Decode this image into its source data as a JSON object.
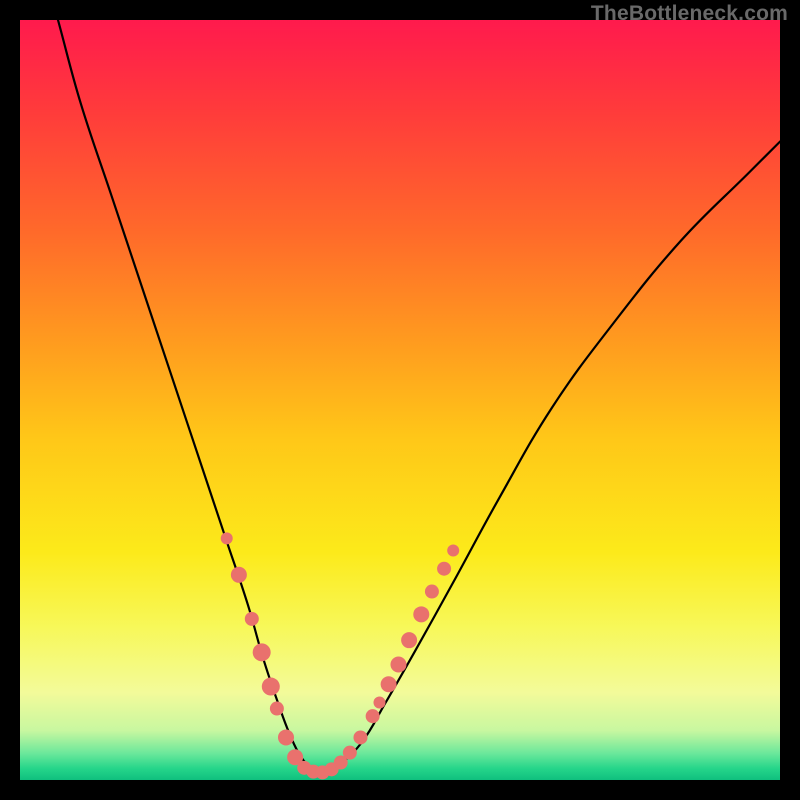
{
  "watermark": "TheBottleneck.com",
  "chart_data": {
    "type": "line",
    "title": "",
    "xlabel": "",
    "ylabel": "",
    "xlim": [
      0,
      100
    ],
    "ylim": [
      0,
      100
    ],
    "background_gradient": {
      "stops": [
        {
          "pos": 0.0,
          "color": "#ff1a4d"
        },
        {
          "pos": 0.12,
          "color": "#ff3b3b"
        },
        {
          "pos": 0.28,
          "color": "#ff6a2a"
        },
        {
          "pos": 0.42,
          "color": "#ff9a1f"
        },
        {
          "pos": 0.55,
          "color": "#ffc718"
        },
        {
          "pos": 0.7,
          "color": "#fcea1a"
        },
        {
          "pos": 0.8,
          "color": "#f7f85a"
        },
        {
          "pos": 0.885,
          "color": "#f3fb9a"
        },
        {
          "pos": 0.935,
          "color": "#c8f7a0"
        },
        {
          "pos": 0.965,
          "color": "#6be89b"
        },
        {
          "pos": 0.985,
          "color": "#25d58a"
        },
        {
          "pos": 1.0,
          "color": "#0fbf7e"
        }
      ]
    },
    "series": [
      {
        "name": "bottleneck-curve",
        "x": [
          5,
          8,
          12,
          16,
          20,
          24,
          27,
          30,
          32,
          34,
          35.5,
          37,
          38.5,
          40,
          42,
          45,
          48,
          52,
          57,
          63,
          70,
          78,
          87,
          96,
          100
        ],
        "y": [
          100,
          89,
          77,
          65,
          53,
          41,
          32,
          23,
          16,
          10,
          6,
          3,
          1.5,
          1,
          2,
          5,
          10,
          17,
          26,
          37,
          49,
          60,
          71,
          80,
          84
        ]
      }
    ],
    "markers": {
      "name": "dot-markers",
      "color": "#e9716d",
      "points": [
        {
          "x": 27.2,
          "y": 31.8,
          "r": 6
        },
        {
          "x": 28.8,
          "y": 27.0,
          "r": 8
        },
        {
          "x": 30.5,
          "y": 21.2,
          "r": 7
        },
        {
          "x": 31.8,
          "y": 16.8,
          "r": 9
        },
        {
          "x": 33.0,
          "y": 12.3,
          "r": 9
        },
        {
          "x": 33.8,
          "y": 9.4,
          "r": 7
        },
        {
          "x": 35.0,
          "y": 5.6,
          "r": 8
        },
        {
          "x": 36.2,
          "y": 3.0,
          "r": 8
        },
        {
          "x": 37.4,
          "y": 1.6,
          "r": 7
        },
        {
          "x": 38.6,
          "y": 1.1,
          "r": 7
        },
        {
          "x": 39.8,
          "y": 1.0,
          "r": 7
        },
        {
          "x": 41.0,
          "y": 1.4,
          "r": 7
        },
        {
          "x": 42.2,
          "y": 2.3,
          "r": 7
        },
        {
          "x": 43.4,
          "y": 3.6,
          "r": 7
        },
        {
          "x": 44.8,
          "y": 5.6,
          "r": 7
        },
        {
          "x": 46.4,
          "y": 8.4,
          "r": 7
        },
        {
          "x": 47.3,
          "y": 10.2,
          "r": 6
        },
        {
          "x": 48.5,
          "y": 12.6,
          "r": 8
        },
        {
          "x": 49.8,
          "y": 15.2,
          "r": 8
        },
        {
          "x": 51.2,
          "y": 18.4,
          "r": 8
        },
        {
          "x": 52.8,
          "y": 21.8,
          "r": 8
        },
        {
          "x": 54.2,
          "y": 24.8,
          "r": 7
        },
        {
          "x": 55.8,
          "y": 27.8,
          "r": 7
        },
        {
          "x": 57.0,
          "y": 30.2,
          "r": 6
        }
      ]
    }
  }
}
